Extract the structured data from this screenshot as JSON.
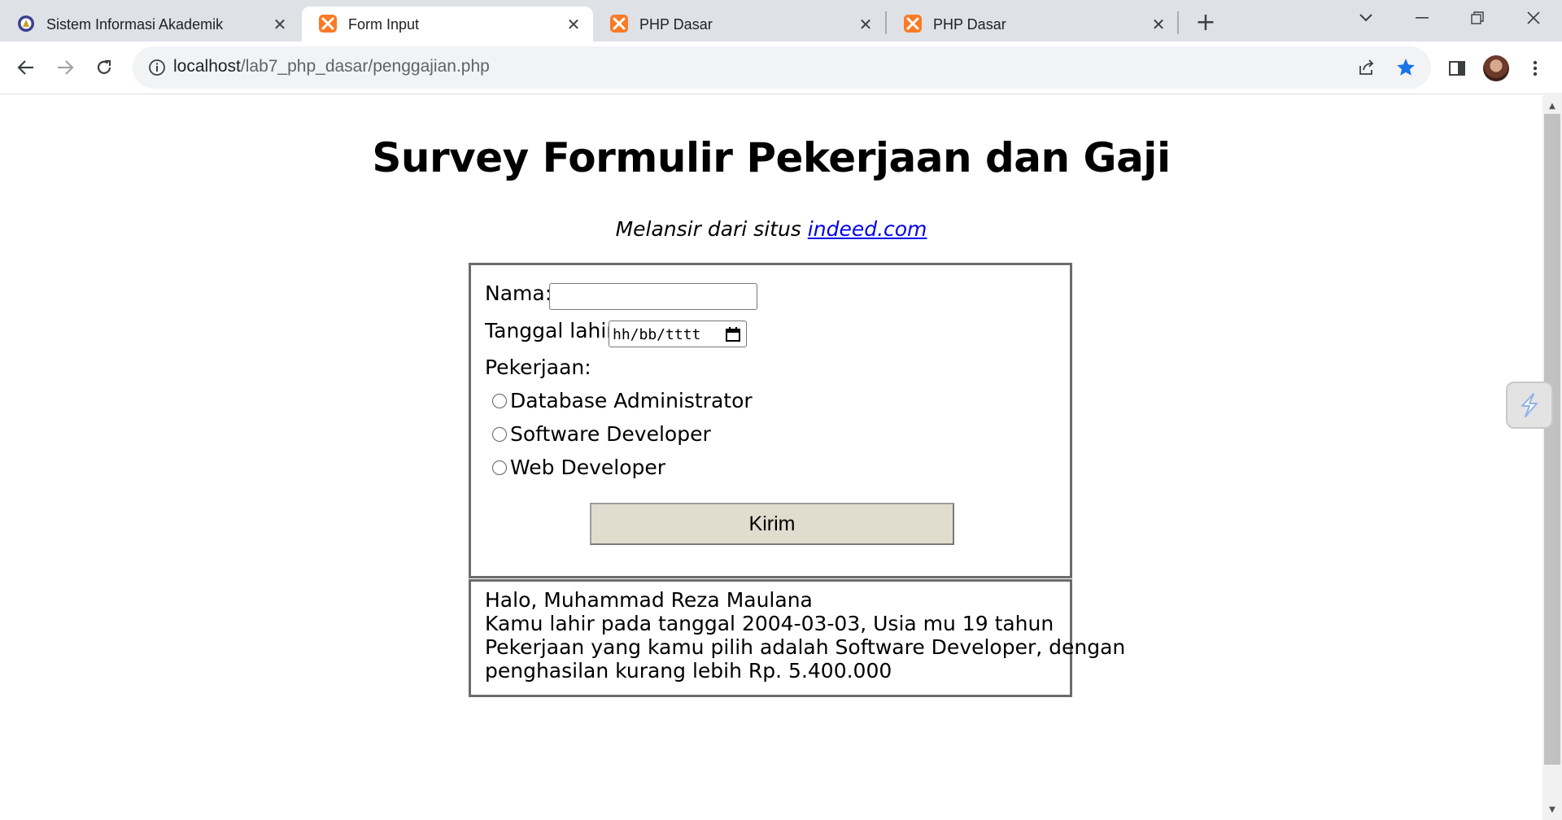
{
  "browser": {
    "tabs": [
      {
        "title": "Sistem Informasi Akademik",
        "favicon": "university-logo-icon",
        "active": false
      },
      {
        "title": "Form Input",
        "favicon": "xampp-icon",
        "active": true
      },
      {
        "title": "PHP Dasar",
        "favicon": "xampp-icon",
        "active": false
      },
      {
        "title": "PHP Dasar",
        "favicon": "xampp-icon",
        "active": false
      }
    ],
    "url_host": "localhost",
    "url_path": "/lab7_php_dasar/penggajian.php",
    "accent_color": "#1a73e8"
  },
  "page": {
    "title": "Survey Formulir Pekerjaan dan Gaji",
    "subtitle_prefix": "Melansir dari situs ",
    "subtitle_link": "indeed.com",
    "form": {
      "name_label": "Nama:",
      "name_value": "",
      "dob_label": "Tanggal lahir:",
      "dob_placeholder": "hh/bb/tttt",
      "job_label": "Pekerjaan:",
      "job_options": [
        "Database Administrator",
        "Software Developer",
        "Web Developer"
      ],
      "submit_label": "Kirim"
    },
    "result": {
      "line1": "Halo, Muhammad Reza Maulana",
      "line2": "Kamu lahir pada tanggal 2004-03-03, Usia mu 19 tahun",
      "line3": "Pekerjaan yang kamu pilih adalah Software Developer, dengan",
      "line4": "penghasilan kurang lebih Rp. 5.400.000"
    }
  }
}
